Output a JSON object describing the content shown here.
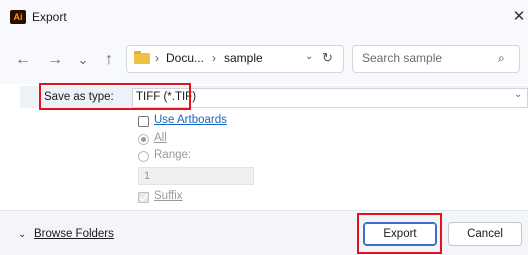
{
  "window": {
    "app_logo": "Ai",
    "title": "Export",
    "close_glyph": "✕"
  },
  "nav": {
    "back_glyph": "←",
    "forward_glyph": "→",
    "recent_glyph": "⌄",
    "up_glyph": "↑",
    "breadcrumb_sep": "›",
    "breadcrumb": [
      "Docu...",
      "sample"
    ],
    "dropdown_glyph": "⌄",
    "refresh_glyph": "↻",
    "search_placeholder": "Search sample",
    "search_glyph": "⌕"
  },
  "form": {
    "save_as_type_label": "Save as type:",
    "save_as_type_value": "TIFF (*.TIF)",
    "dropdown_glyph": "⌄",
    "use_artboards_label": "Use Artboards",
    "use_artboards_checked": false,
    "all_label": "All",
    "all_selected": true,
    "range_label": "Range:",
    "range_selected": false,
    "range_value": "1",
    "suffix_label": "Suffix",
    "suffix_checked": true
  },
  "footer": {
    "browse_chev": "⌄",
    "browse_folders_label": "Browse Folders",
    "export_button": "Export",
    "cancel_button": "Cancel"
  },
  "colors": {
    "highlight_box": "#e2131b",
    "link": "#1766c2",
    "primary_border": "#3a6fd1"
  }
}
